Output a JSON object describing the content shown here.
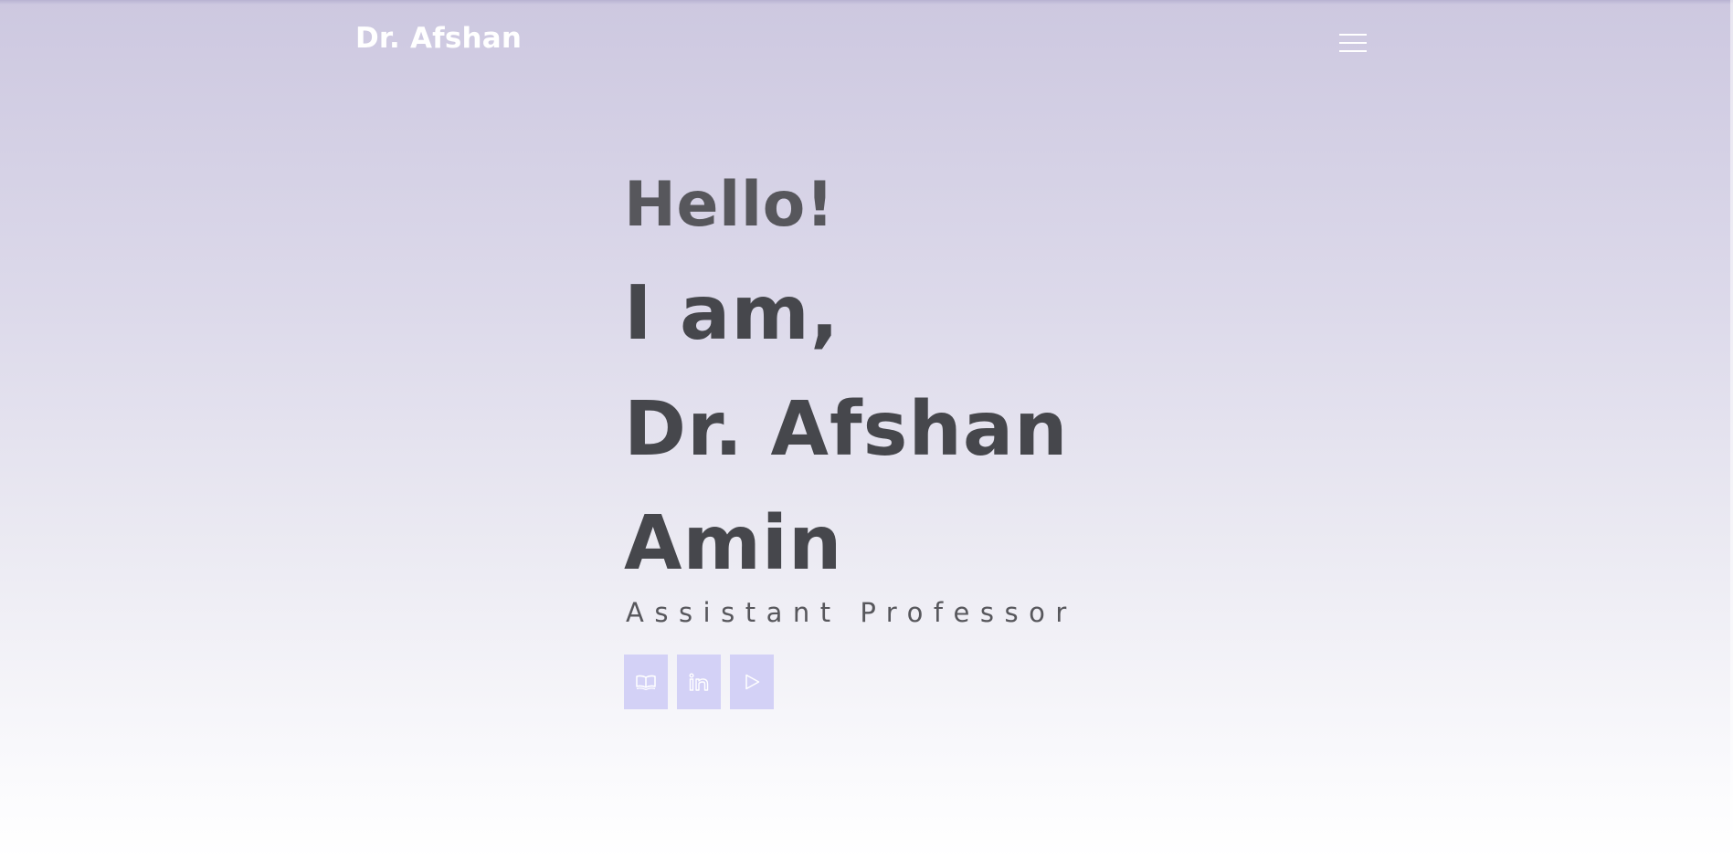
{
  "header": {
    "brand": "Dr. Afshan",
    "menu_icon": "hamburger-menu-icon"
  },
  "hero": {
    "greeting": "Hello!",
    "intro_line_1": "I am,",
    "intro_line_2": "Dr. Afshan",
    "intro_line_3": "Amin",
    "role": "Assistant Professor"
  },
  "social_links": [
    {
      "icon": "book-icon"
    },
    {
      "icon": "linkedin-icon"
    },
    {
      "icon": "play-icon"
    }
  ],
  "colors": {
    "background_top": "#cdc8e0",
    "background_bottom": "#ffffff",
    "heading_text": "#46474c",
    "greeting_text": "#57575c",
    "social_button": "#d3d1f6",
    "brand_text": "#ffffff"
  }
}
